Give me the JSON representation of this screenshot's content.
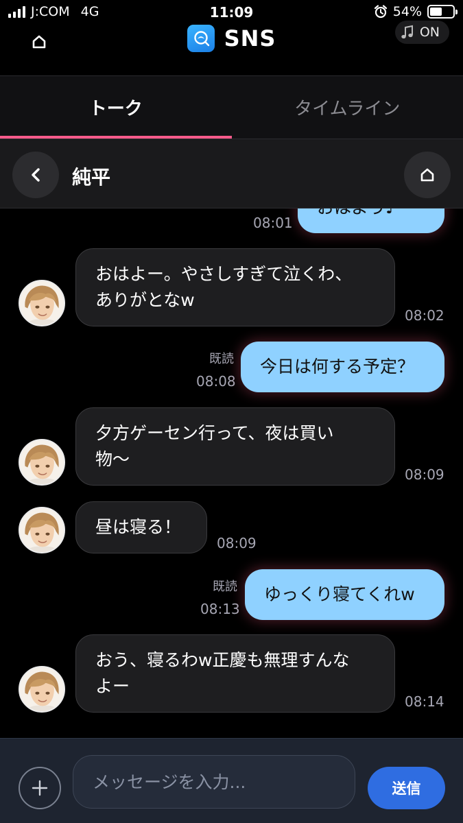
{
  "status_bar": {
    "carrier": "J:COM",
    "network": "4G",
    "time": "11:09",
    "battery": "54%",
    "battery_level": 0.54
  },
  "header": {
    "app_name": "SNS",
    "music_status": "ON"
  },
  "tabs": [
    {
      "label": "トーク",
      "active": true
    },
    {
      "label": "タイムライン",
      "active": false
    }
  ],
  "chat": {
    "partner_name": "純平"
  },
  "messages": [
    {
      "direction": "out",
      "text": "おはよう♪",
      "time": "08:01"
    },
    {
      "direction": "in",
      "line1": "おはよー。やさしすぎて泣くわ、",
      "line2": "ありがとなw",
      "time": "08:02"
    },
    {
      "direction": "out",
      "read": "既読",
      "text": "今日は何する予定？",
      "time": "08:08"
    },
    {
      "direction": "in",
      "line1": "夕方ゲーセン行って、夜は買い",
      "line2": "物〜",
      "time": "08:09"
    },
    {
      "direction": "in",
      "text": "昼は寝る！",
      "time": "08:09"
    },
    {
      "direction": "out",
      "read": "既読",
      "text": "ゆっくり寝てくれw",
      "time": "08:13"
    },
    {
      "direction": "in",
      "line1": "おう、寝るわw正慶も無理すんな",
      "line2": "よー",
      "time": "08:14"
    }
  ],
  "composer": {
    "placeholder": "メッセージを入力...",
    "send_label": "送信"
  },
  "colors": {
    "accent_pink": "#ff5b8b",
    "outgoing_bubble": "#8fd1ff",
    "send_button": "#2f6de1"
  }
}
